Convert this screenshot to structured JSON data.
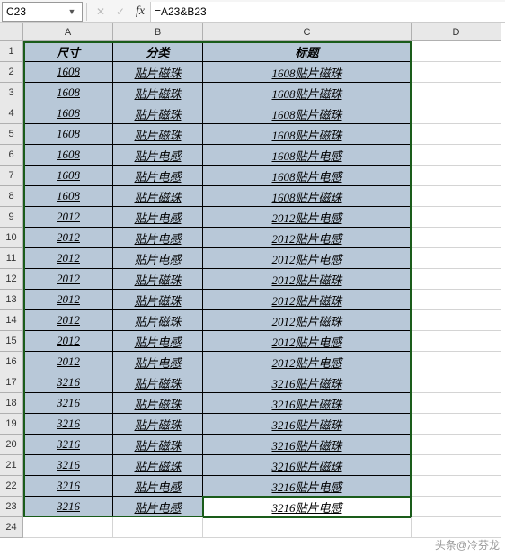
{
  "nameBox": "C23",
  "formula": "=A23&B23",
  "columns": [
    "A",
    "B",
    "C",
    "D"
  ],
  "colWidths": {
    "A": 100,
    "B": 100,
    "C": 232,
    "D": 100
  },
  "headers": {
    "A": "尺寸",
    "B": "分类",
    "C": "标题"
  },
  "rows": [
    {
      "n": 1,
      "A": "尺寸",
      "B": "分类",
      "C": "标题",
      "header": true
    },
    {
      "n": 2,
      "A": "1608",
      "B": "贴片磁珠",
      "C": "1608贴片磁珠"
    },
    {
      "n": 3,
      "A": "1608",
      "B": "贴片磁珠",
      "C": "1608贴片磁珠"
    },
    {
      "n": 4,
      "A": "1608",
      "B": "贴片磁珠",
      "C": "1608贴片磁珠"
    },
    {
      "n": 5,
      "A": "1608",
      "B": "贴片磁珠",
      "C": "1608贴片磁珠"
    },
    {
      "n": 6,
      "A": "1608",
      "B": "贴片电感",
      "C": "1608贴片电感"
    },
    {
      "n": 7,
      "A": "1608",
      "B": "贴片电感",
      "C": "1608贴片电感"
    },
    {
      "n": 8,
      "A": "1608",
      "B": "贴片磁珠",
      "C": "1608贴片磁珠"
    },
    {
      "n": 9,
      "A": "2012",
      "B": "贴片电感",
      "C": "2012贴片电感"
    },
    {
      "n": 10,
      "A": "2012",
      "B": "贴片电感",
      "C": "2012贴片电感"
    },
    {
      "n": 11,
      "A": "2012",
      "B": "贴片电感",
      "C": "2012贴片电感"
    },
    {
      "n": 12,
      "A": "2012",
      "B": "贴片磁珠",
      "C": "2012贴片磁珠"
    },
    {
      "n": 13,
      "A": "2012",
      "B": "贴片磁珠",
      "C": "2012贴片磁珠"
    },
    {
      "n": 14,
      "A": "2012",
      "B": "贴片磁珠",
      "C": "2012贴片磁珠"
    },
    {
      "n": 15,
      "A": "2012",
      "B": "贴片电感",
      "C": "2012贴片电感"
    },
    {
      "n": 16,
      "A": "2012",
      "B": "贴片电感",
      "C": "2012贴片电感"
    },
    {
      "n": 17,
      "A": "3216",
      "B": "贴片磁珠",
      "C": "3216贴片磁珠"
    },
    {
      "n": 18,
      "A": "3216",
      "B": "贴片磁珠",
      "C": "3216贴片磁珠"
    },
    {
      "n": 19,
      "A": "3216",
      "B": "贴片磁珠",
      "C": "3216贴片磁珠"
    },
    {
      "n": 20,
      "A": "3216",
      "B": "贴片磁珠",
      "C": "3216贴片磁珠"
    },
    {
      "n": 21,
      "A": "3216",
      "B": "贴片磁珠",
      "C": "3216贴片磁珠"
    },
    {
      "n": 22,
      "A": "3216",
      "B": "贴片电感",
      "C": "3216贴片电感"
    },
    {
      "n": 23,
      "A": "3216",
      "B": "贴片电感",
      "C": "3216贴片电感",
      "active": true
    },
    {
      "n": 24,
      "A": "",
      "B": "",
      "C": "",
      "empty": true
    }
  ],
  "activeCell": "C23",
  "watermark": "头条@冷芬龙"
}
